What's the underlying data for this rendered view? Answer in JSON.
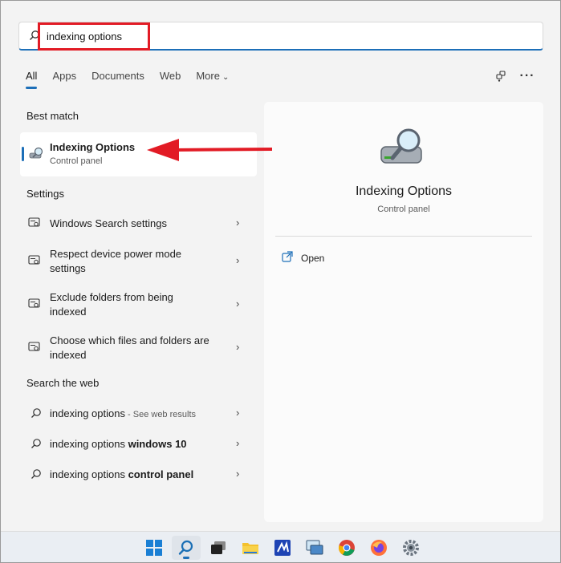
{
  "search": {
    "value": "indexing options",
    "placeholder": ""
  },
  "tabs": [
    {
      "label": "All",
      "active": true
    },
    {
      "label": "Apps"
    },
    {
      "label": "Documents"
    },
    {
      "label": "Web"
    },
    {
      "label": "More"
    }
  ],
  "sections": {
    "best_match": "Best match",
    "settings": "Settings",
    "search_web": "Search the web"
  },
  "best_match": {
    "title": "Indexing Options",
    "subtitle": "Control panel"
  },
  "settings_items": [
    {
      "line1": "Windows Search settings",
      "line2": ""
    },
    {
      "line1": "Respect device power mode",
      "line2": "settings"
    },
    {
      "line1": "Exclude folders from being",
      "line2": "indexed"
    },
    {
      "line1": "Choose which files and folders are",
      "line2": "indexed"
    }
  ],
  "web_items": [
    {
      "normal": "indexing options",
      "bold": "",
      "suffix": " - See web results"
    },
    {
      "normal": "indexing options ",
      "bold": "windows 10",
      "suffix": ""
    },
    {
      "normal": "indexing options ",
      "bold": "control panel",
      "suffix": ""
    }
  ],
  "preview": {
    "title": "Indexing Options",
    "subtitle": "Control panel",
    "open_label": "Open"
  },
  "colors": {
    "accent": "#1d6fb8",
    "annotation": "#e21b25"
  },
  "icons": {
    "search": "search-icon",
    "share": "share-icon",
    "more": "more-icon",
    "settings_item": "settings-window-icon",
    "open": "open-external-icon"
  }
}
